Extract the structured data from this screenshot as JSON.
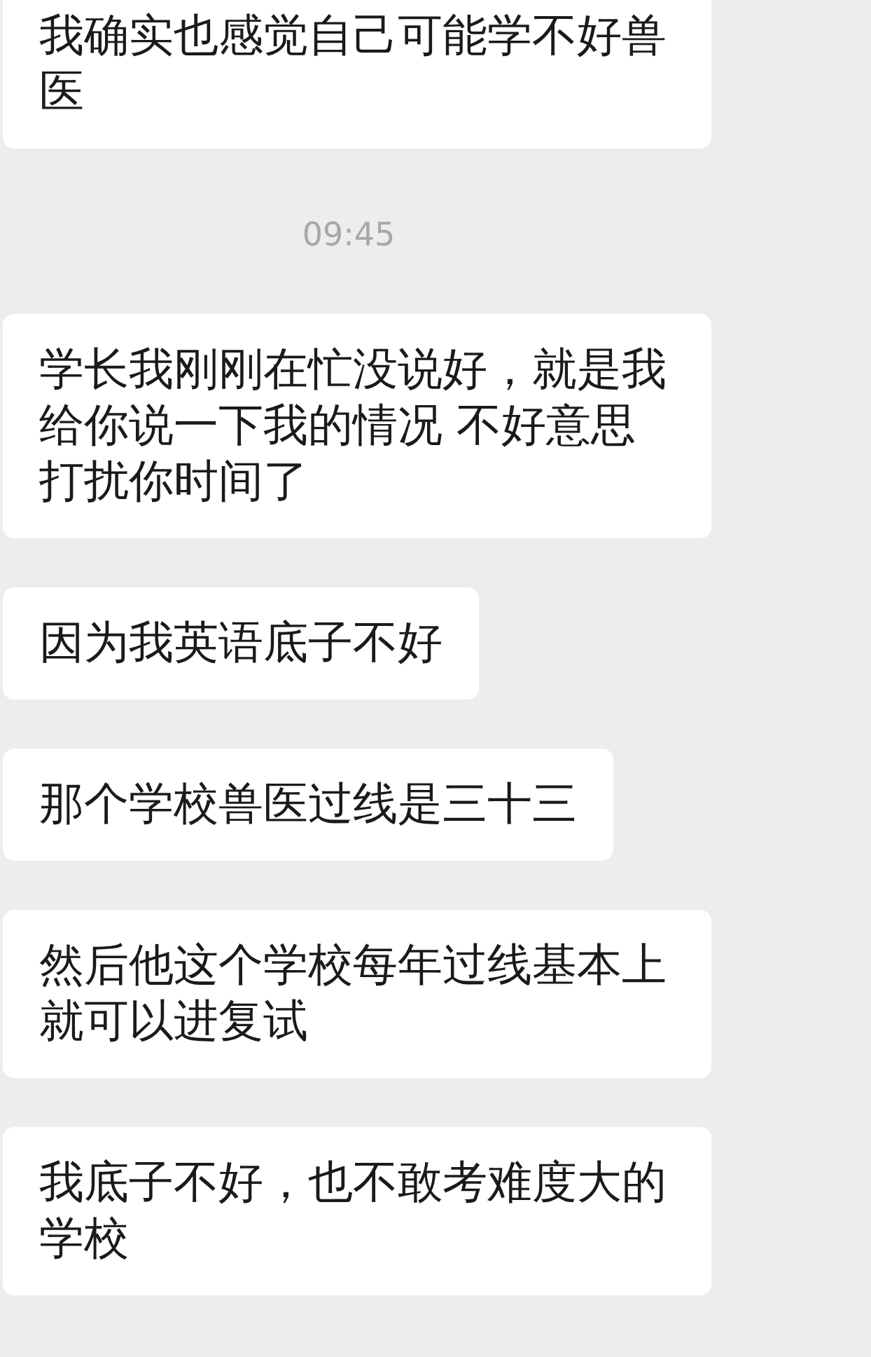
{
  "messages": [
    {
      "kind": "bubble",
      "text": "我确实也感觉自己可能学不好兽医"
    },
    {
      "kind": "time",
      "text": "09:45"
    },
    {
      "kind": "bubble",
      "text": "学长我刚刚在忙没说好，就是我给你说一下我的情况 不好意思打扰你时间了"
    },
    {
      "kind": "bubble",
      "text": "因为我英语底子不好"
    },
    {
      "kind": "bubble",
      "text": "那个学校兽医过线是三十三"
    },
    {
      "kind": "bubble",
      "text": "然后他这个学校每年过线基本上就可以进复试"
    },
    {
      "kind": "bubble",
      "text": "我底子不好，也不敢考难度大的学校"
    }
  ]
}
